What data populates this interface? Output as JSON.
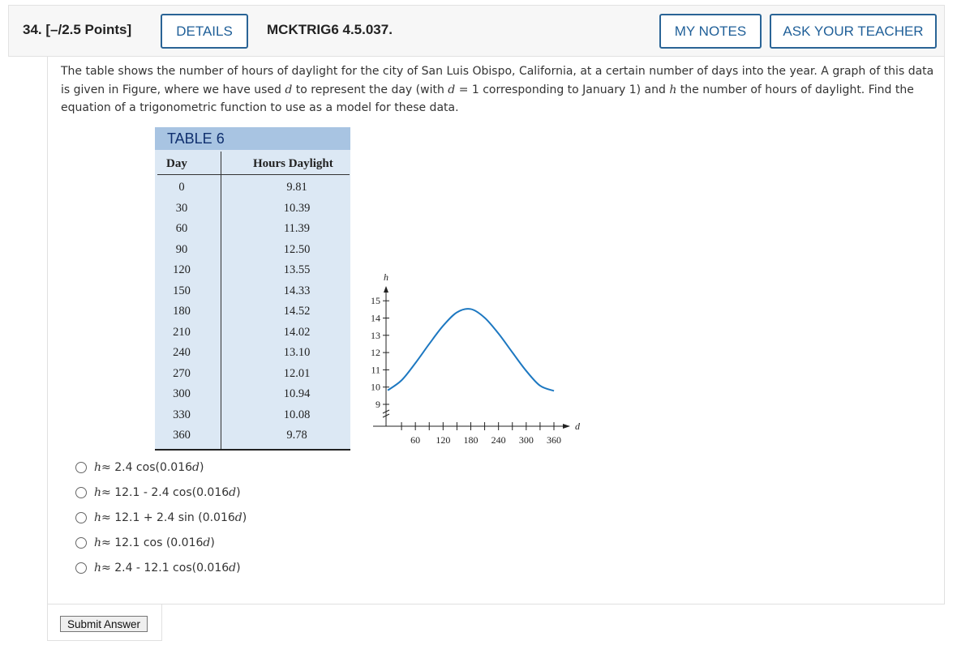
{
  "header": {
    "question_number": "34.  [–/2.5 Points]",
    "details_label": "DETAILS",
    "question_code": "MCKTRIG6 4.5.037.",
    "my_notes_label": "MY NOTES",
    "ask_teacher_label": "ASK YOUR TEACHER",
    "accent_color": "#1f5f98"
  },
  "prompt": {
    "p1": "The table shows the number of hours of daylight for the city of San Luis Obispo, California, at a certain number of days into the year. A graph of this data is given in Figure, where we have used ",
    "var_d1": "d",
    "p2": " to represent the day (with ",
    "var_d2": "d",
    "p3": " = 1 corresponding to January 1) and ",
    "var_h": "h",
    "p4": " the number of hours of daylight. Find the equation of a trigonometric function to use as a model for these data."
  },
  "table": {
    "caption": "TABLE 6",
    "col_day": "Day",
    "col_hours": "Hours Daylight",
    "rows": [
      [
        "0",
        "9.81"
      ],
      [
        "30",
        "10.39"
      ],
      [
        "60",
        "11.39"
      ],
      [
        "90",
        "12.50"
      ],
      [
        "120",
        "13.55"
      ],
      [
        "150",
        "14.33"
      ],
      [
        "180",
        "14.52"
      ],
      [
        "210",
        "14.02"
      ],
      [
        "240",
        "13.10"
      ],
      [
        "270",
        "12.01"
      ],
      [
        "300",
        "10.94"
      ],
      [
        "330",
        "10.08"
      ],
      [
        "360",
        "9.78"
      ]
    ]
  },
  "chart_data": {
    "type": "line",
    "xlabel": "d",
    "ylabel": "h",
    "x_ticks": [
      "60",
      "120",
      "180",
      "240",
      "300",
      "360"
    ],
    "y_ticks": [
      "9",
      "10",
      "11",
      "12",
      "13",
      "14",
      "15"
    ],
    "xlim": [
      0,
      365
    ],
    "ylim": [
      8,
      15
    ],
    "series": [
      {
        "x": [
          0,
          30,
          60,
          90,
          120,
          150,
          180,
          210,
          240,
          270,
          300,
          330,
          360
        ],
        "values": [
          9.81,
          10.39,
          11.39,
          12.5,
          13.55,
          14.33,
          14.52,
          14.02,
          13.1,
          12.01,
          10.94,
          10.08,
          9.78
        ]
      }
    ],
    "line_color": "#1d78c1",
    "axis_break": true
  },
  "choices": [
    {
      "var": "h",
      "rest": " ≈ 2.4 cos(0.016",
      "var2": "d",
      "tail": ")"
    },
    {
      "var": "h",
      "rest": " ≈ 12.1 - 2.4 cos(0.016",
      "var2": "d",
      "tail": ")"
    },
    {
      "var": "h",
      "rest": " ≈ 12.1 + 2.4 sin (0.016",
      "var2": "d",
      "tail": ")"
    },
    {
      "var": "h",
      "rest": " ≈ 12.1 cos (0.016",
      "var2": "d",
      "tail": ")"
    },
    {
      "var": "h",
      "rest": " ≈ 2.4 - 12.1 cos(0.016",
      "var2": "d",
      "tail": ")"
    }
  ],
  "submit_label": "Submit Answer"
}
